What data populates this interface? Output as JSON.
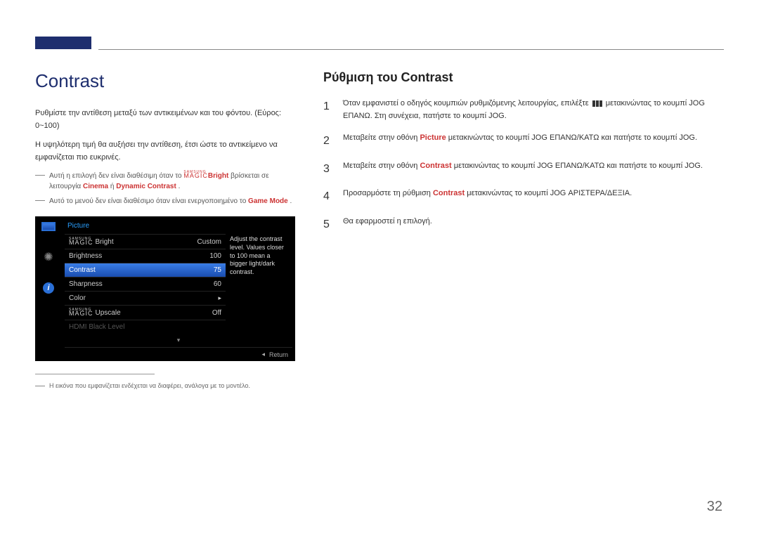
{
  "page_number": "32",
  "left": {
    "title": "Contrast",
    "intro_a": "Ρυθμίστε την αντίθεση μεταξύ των αντικειμένων και του φόντου. (Εύρος: 0~100)",
    "intro_b": "Η υψηλότερη τιμή θα αυξήσει την αντίθεση, έτσι ώστε το αντικείμενο να εμφανίζεται πιο ευκρινές.",
    "note1_pre": "Αυτή η επιλογή δεν είναι διαθέσιμη όταν το ",
    "note1_magic_top": "SAMSUNG",
    "note1_magic_bot": "MAGIC",
    "note1_bright": "Bright",
    "note1_mid": " βρίσκεται σε λειτουργία ",
    "note1_hl1": "Cinema",
    "note1_or": " ή ",
    "note1_hl2": "Dynamic Contrast",
    "note1_end": ".",
    "note2_pre": "Αυτό το μενού δεν είναι διαθέσιμο όταν είναι ενεργοποιημένο το ",
    "note2_hl": "Game Mode",
    "note2_end": ".",
    "footnote": "Η εικόνα που εμφανίζεται ενδέχεται να διαφέρει, ανάλογα με το μοντέλο."
  },
  "osd": {
    "header": "Picture",
    "hint": "Adjust the contrast level. Values closer to 100 mean a bigger light/dark contrast.",
    "rows": [
      {
        "type": "magic",
        "top": "SAMSUNG",
        "bot": "MAGIC",
        "suffix": "Bright",
        "val": "Custom",
        "sel": false,
        "dim": false
      },
      {
        "label": "Brightness",
        "val": "100",
        "sel": false,
        "dim": false
      },
      {
        "label": "Contrast",
        "val": "75",
        "sel": true,
        "dim": false
      },
      {
        "label": "Sharpness",
        "val": "60",
        "sel": false,
        "dim": false
      },
      {
        "label": "Color",
        "val": "▸",
        "sel": false,
        "dim": false
      },
      {
        "type": "magic",
        "top": "SAMSUNG",
        "bot": "MAGIC",
        "suffix": "Upscale",
        "val": "Off",
        "sel": false,
        "dim": false
      },
      {
        "label": "HDMI Black Level",
        "val": "",
        "sel": false,
        "dim": true
      }
    ],
    "footer_return": "Return"
  },
  "right": {
    "title": "Ρύθμιση του Contrast",
    "steps": [
      {
        "n": "1",
        "pre": "Όταν εμφανιστεί ο οδηγός κουμπιών ρυθμιζόμενης λειτουργίας, επιλέξτε ",
        "post": " μετακινώντας το κουμπί JOG ΕΠΑΝΩ. Στη συνέχεια, πατήστε το κουμπί JOG.",
        "has_icon": true
      },
      {
        "n": "2",
        "pre": "Μεταβείτε στην οθόνη ",
        "hl": "Picture",
        "post": " μετακινώντας το κουμπί JOG ΕΠΑΝΩ/ΚΑΤΩ και πατήστε το κουμπί JOG."
      },
      {
        "n": "3",
        "pre": "Μεταβείτε στην οθόνη ",
        "hl": "Contrast",
        "post": " μετακινώντας το κουμπί JOG ΕΠΑΝΩ/ΚΑΤΩ και πατήστε το κουμπί JOG."
      },
      {
        "n": "4",
        "pre": "Προσαρμόστε τη ρύθμιση ",
        "hl": "Contrast",
        "post": " μετακινώντας το κουμπί JOG ΑΡΙΣΤΕΡΑ/ΔΕΞΙΑ."
      },
      {
        "n": "5",
        "pre": "Θα εφαρμοστεί η επιλογή."
      }
    ]
  }
}
